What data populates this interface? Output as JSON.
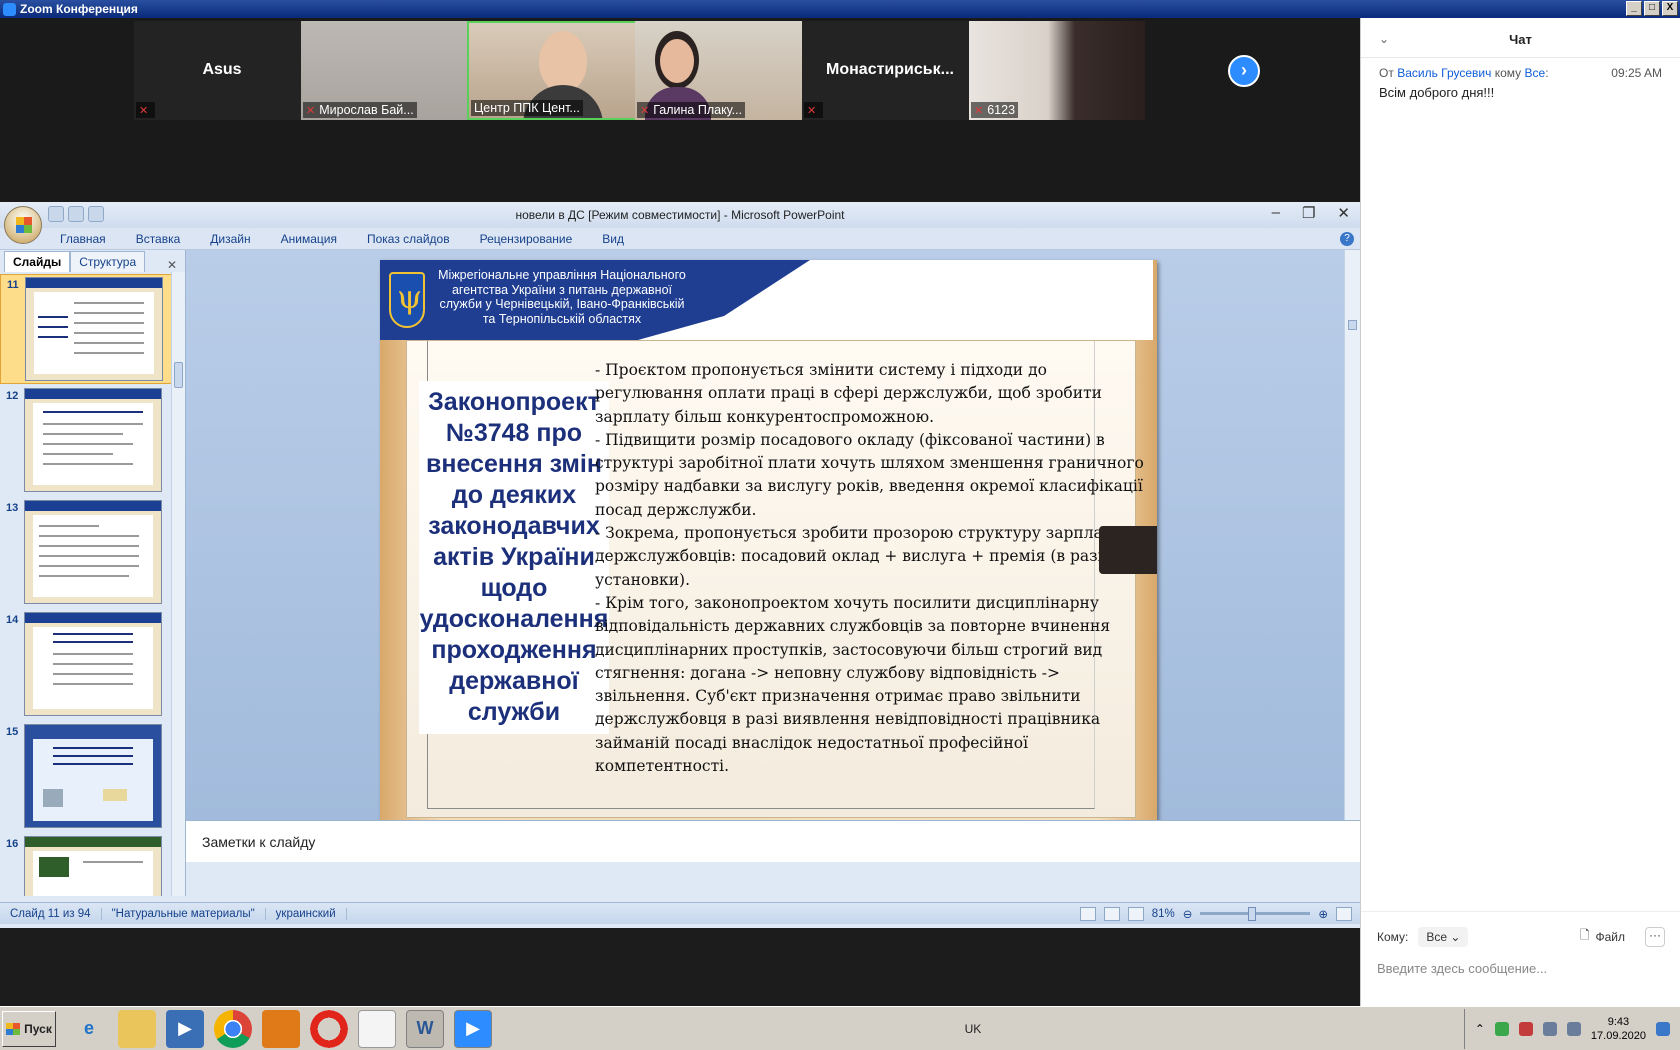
{
  "zoom": {
    "title": "Zoom Конференция",
    "window_controls": [
      "_",
      "□",
      "X"
    ]
  },
  "participants": [
    {
      "name": "Asus",
      "label": "",
      "video": false
    },
    {
      "name": "",
      "label": "Мирослав Бай...",
      "video": true
    },
    {
      "name": "",
      "label": "Центр ППК Цент...",
      "video": true,
      "active": true
    },
    {
      "name": "",
      "label": "Галина Плаку...",
      "video": true
    },
    {
      "name": "Монастириськ...",
      "label": "",
      "video": false
    },
    {
      "name": "",
      "label": "6123",
      "video": true
    }
  ],
  "next_page_icon": "chevron-right-icon",
  "chat": {
    "title": "Чат",
    "messages": [
      {
        "prefix": "От",
        "from": "Василь Грусевич",
        "to_word": "кому",
        "to": "Все",
        "time": "09:25 AM",
        "text": "Всім доброго дня!!!"
      }
    ],
    "to_label": "Кому:",
    "to_value": "Все",
    "file_label": "Файл",
    "more": "···",
    "input_placeholder": "Введите здесь сообщение..."
  },
  "ppt": {
    "doc_title": "новели в ДС [Режим совместимости] - Microsoft PowerPoint",
    "tabs": [
      "Главная",
      "Вставка",
      "Дизайн",
      "Анимация",
      "Показ слайдов",
      "Рецензирование",
      "Вид"
    ],
    "left_tabs": [
      "Слайды",
      "Структура"
    ],
    "thumbs": [
      {
        "num": "11",
        "selected": true
      },
      {
        "num": "12",
        "selected": false
      },
      {
        "num": "13",
        "selected": false
      },
      {
        "num": "14",
        "selected": false
      },
      {
        "num": "15",
        "selected": false
      },
      {
        "num": "16",
        "selected": false
      }
    ],
    "notes": "Заметки к слайду",
    "status": {
      "slide": "Слайд 11 из 94",
      "theme": "\"Натуральные материалы\"",
      "lang": "украинский",
      "zoom": "81%"
    }
  },
  "slide": {
    "org": "Міжрегіональне управління Національного агентства України з питань державної служби  у Чернівецькій, Івано-Франківській та Тернопільській областях",
    "bill": "Законопроект №3748 про внесення змін до деяких законодавчих актів України щодо удосконалення проходження державної служби",
    "paragraphs": [
      "- Проєктом пропонується змінити систему і підходи до регулювання оплати праці в сфері держслужби, щоб зробити зарплату більш конкурентоспроможною.",
      "- Підвищити розмір посадового окладу (фіксованої частини) в структурі заробітної плати хочуть шляхом зменшення граничного розміру надбавки за вислугу років, введення окремої класифікації посад держслужби.",
      "- Зокрема, пропонується зробити прозорою структуру зарплати держслужбовців: посадовий оклад + вислуга + премія (в разі установки).",
      "- Крім того, законопроектом хочуть посилити дисциплінарну відповідальність державних службовців за повторне вчинення дисциплінарних проступків, застосовуючи більш строгий вид стягнення: догана -> неповну службову відповідність -> звільнення. Суб'єкт призначення отримає право звільнити держслужбовця в разі виявлення невідповідності працівника займаній посаді внаслідок недостатньої професійної компетентності."
    ]
  },
  "taskbar": {
    "start": "Пуск",
    "lang": "UK",
    "time": "9:43",
    "date": "17.09.2020"
  }
}
